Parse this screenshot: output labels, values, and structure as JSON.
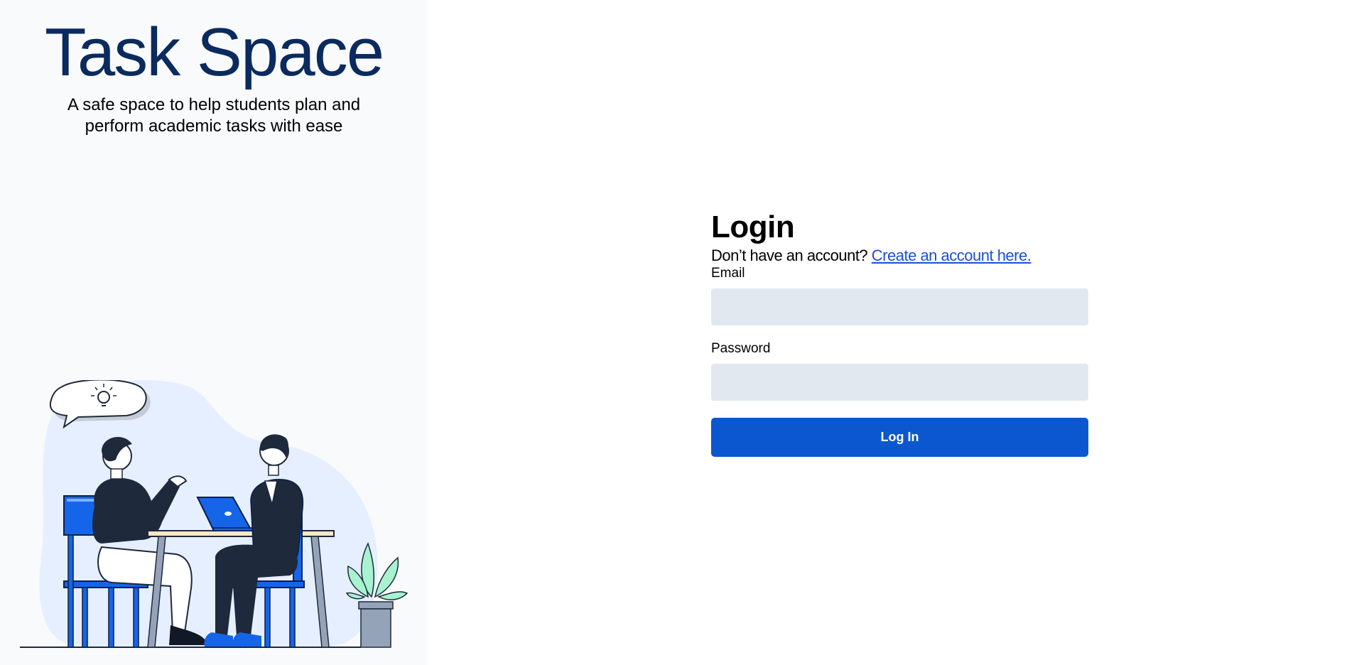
{
  "brand": {
    "title": "Task Space",
    "tagline": "A safe space to help students plan and perform academic tasks with ease"
  },
  "login": {
    "heading": "Login",
    "signup_prompt": "Don’t have an account?",
    "signup_link": "Create an account here.",
    "email_label": "Email",
    "email_value": "",
    "password_label": "Password",
    "password_value": "",
    "submit_label": "Log In"
  },
  "colors": {
    "title": "#0b2a5e",
    "accent": "#0b57d0",
    "link": "#1d4ed8",
    "input_bg": "#e2e8f0",
    "panel_bg": "#f8fafc"
  }
}
